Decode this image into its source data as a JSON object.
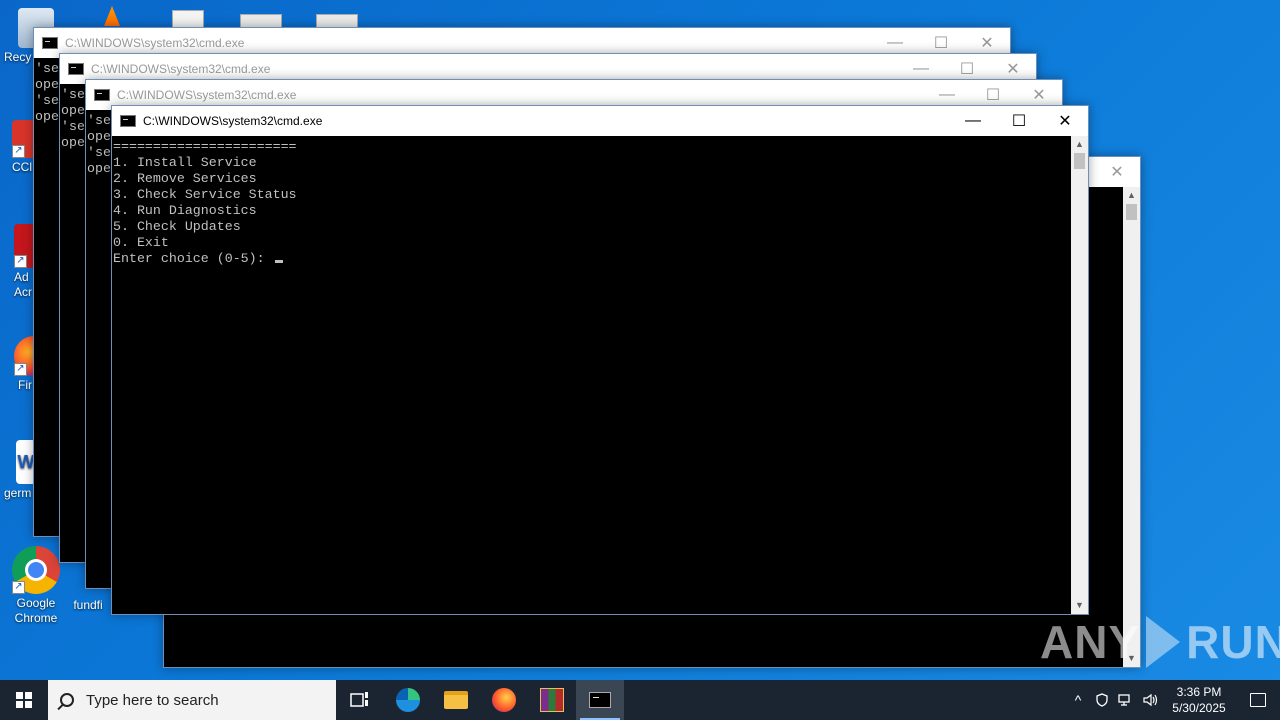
{
  "desktop": {
    "icons": [
      {
        "label": "Recy"
      },
      {
        "label": "CCl"
      },
      {
        "label": "Ad\nAcr"
      },
      {
        "label": "Fir"
      },
      {
        "label": "germ"
      },
      {
        "label": "Google\nChrome"
      },
      {
        "label": "fundfi"
      }
    ]
  },
  "windows": {
    "w1": {
      "title": "C:\\WINDOWS\\system32\\cmd.exe",
      "lines": "'se\nope\n'se\nope"
    },
    "w2": {
      "title": "C:\\WINDOWS\\system32\\cmd.exe",
      "lines": "'se\nope\n'se\nope"
    },
    "w3": {
      "title": "C:\\WINDOWS\\system32\\cmd.exe",
      "lines": "'se\nope\n'se\nope"
    },
    "active": {
      "title": "C:\\WINDOWS\\system32\\cmd.exe",
      "separator": "=======================",
      "menu": [
        "1. Install Service",
        "2. Remove Services",
        "3. Check Service Status",
        "4. Run Diagnostics",
        "5. Check Updates",
        "0. Exit"
      ],
      "prompt": "Enter choice (0-5): "
    },
    "controls": {
      "minimize": "—",
      "maximize": "☐",
      "close": "✕"
    }
  },
  "watermark": {
    "left": "ANY",
    "right": "RUN"
  },
  "taskbar": {
    "search_placeholder": "Type here to search",
    "apps": [
      "task-view",
      "edge",
      "file-explorer",
      "firefox",
      "winrar",
      "cmd"
    ],
    "tray": {
      "chevron": "^",
      "time": "3:36 PM",
      "date": "5/30/2025"
    }
  },
  "colors": {
    "desktop": "#0b78d7",
    "taskbar": "#1b2532",
    "console_bg": "#000000",
    "console_fg": "#c0c0c0"
  }
}
